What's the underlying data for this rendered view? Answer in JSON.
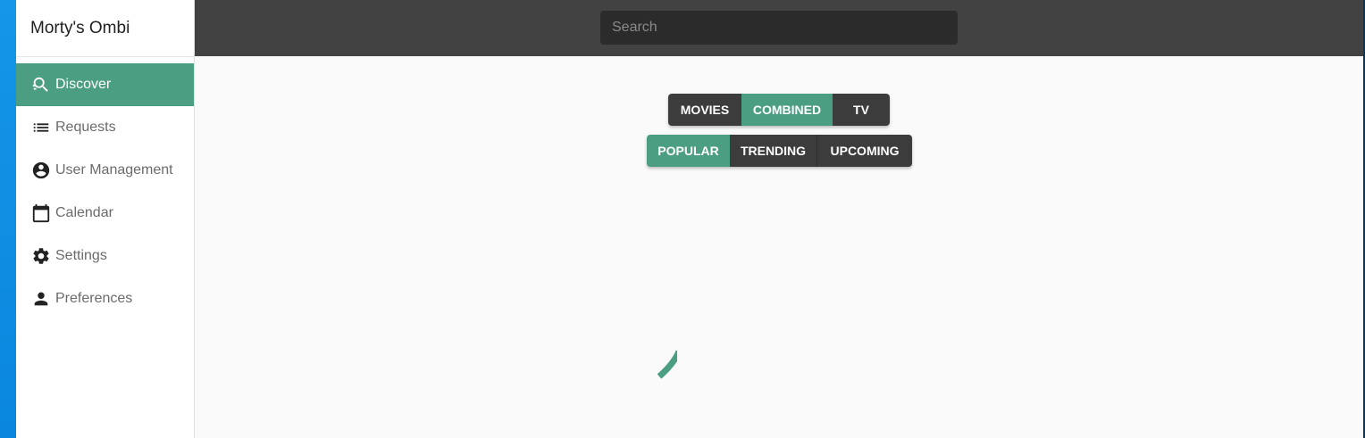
{
  "app": {
    "title": "Morty's Ombi"
  },
  "sidebar": {
    "items": [
      {
        "label": "Discover",
        "icon": "discover-icon",
        "active": true
      },
      {
        "label": "Requests",
        "icon": "list-icon",
        "active": false
      },
      {
        "label": "User Management",
        "icon": "account-circle-icon",
        "active": false
      },
      {
        "label": "Calendar",
        "icon": "calendar-icon",
        "active": false
      },
      {
        "label": "Settings",
        "icon": "gear-icon",
        "active": false
      },
      {
        "label": "Preferences",
        "icon": "person-icon",
        "active": false
      }
    ]
  },
  "search": {
    "placeholder": "Search",
    "value": ""
  },
  "content_type": {
    "options": [
      "MOVIES",
      "COMBINED",
      "TV"
    ],
    "selected": "COMBINED"
  },
  "sort": {
    "options": [
      "POPULAR",
      "TRENDING",
      "UPCOMING"
    ],
    "selected": "POPULAR"
  },
  "colors": {
    "accent": "#4b9e82",
    "topbar": "#424242",
    "button_dark": "#3c3c3c",
    "background": "#fafafa"
  },
  "loading": {
    "spinner": "loading-spinner-icon"
  }
}
